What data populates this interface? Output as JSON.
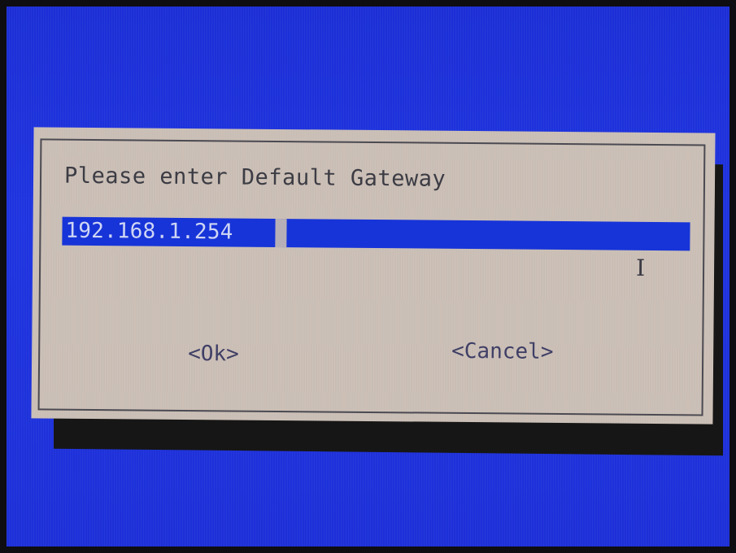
{
  "dialog": {
    "prompt": "Please enter Default Gateway",
    "input": {
      "value": "192.168.1.254"
    },
    "buttons": {
      "ok_label": "<Ok>",
      "cancel_label": "<Cancel>"
    }
  },
  "icons": {
    "text_cursor": "i-beam-cursor-icon"
  },
  "colors": {
    "screen_background": "#1f34e0",
    "dialog_background": "#c9bdb4",
    "field_background": "#1734d8",
    "text": "#3c3c44"
  }
}
